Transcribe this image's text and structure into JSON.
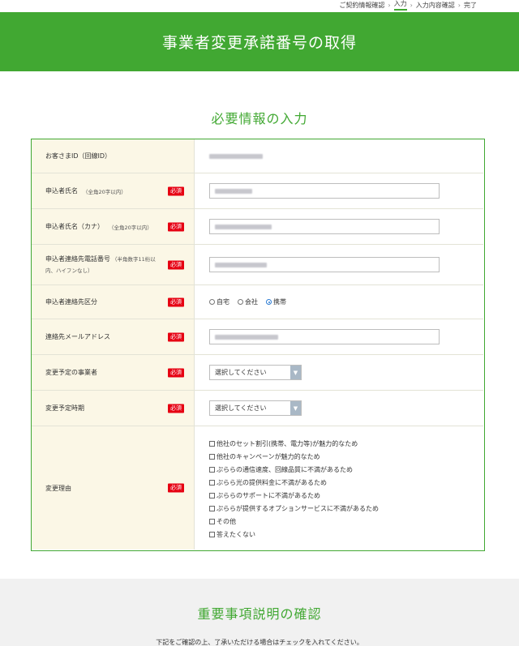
{
  "breadcrumb": [
    "ご契約情報確認",
    "入力",
    "入力内容確認",
    "完了"
  ],
  "header": {
    "title": "事業者変更承諾番号の取得"
  },
  "form_section": {
    "title": "必要情報の入力"
  },
  "required_label": "必須",
  "rows": {
    "customer_id": {
      "label": "お客さまID（回線ID）"
    },
    "name": {
      "label": "申込者氏名",
      "sub": "（全角20字以内）"
    },
    "kana": {
      "label": "申込者氏名（カナ）",
      "sub": "（全角20字以内）"
    },
    "phone": {
      "label": "申込者連絡先電話番号",
      "sub": "（半角数字11桁以内、ハイフンなし）"
    },
    "contact_type": {
      "label": "申込者連絡先区分",
      "options": [
        "自宅",
        "会社",
        "携帯"
      ],
      "selected": "携帯"
    },
    "email": {
      "label": "連絡先メールアドレス"
    },
    "provider": {
      "label": "変更予定の事業者",
      "value": "選択してください"
    },
    "timing": {
      "label": "変更予定時期",
      "value": "選択してください"
    },
    "reason": {
      "label": "変更理由",
      "options": [
        "他社のセット割引(携帯、電力等)が魅力的なため",
        "他社のキャンペーンが魅力的なため",
        "ぷららの通信速度、回線品質に不満があるため",
        "ぷらら光の提供料金に不満があるため",
        "ぷららのサポートに不満があるため",
        "ぷららが提供するオプションサービスに不満があるため",
        "その他",
        "答えたくない"
      ]
    }
  },
  "important_section": {
    "title": "重要事項説明の確認",
    "note": "下記をご確認の上、了承いただける場合はチェックを入れてください。"
  },
  "colors": {
    "brand_green": "#41a832",
    "required_red": "#e60012",
    "label_bg": "#fbf7e6"
  }
}
